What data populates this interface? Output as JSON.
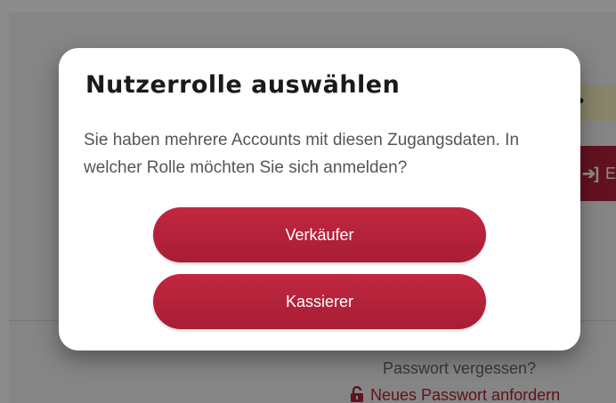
{
  "modal": {
    "title": "Nutzerrolle auswählen",
    "text": "Sie haben mehrere Accounts mit diesen Zugangsdaten. In welcher Rolle möchten Sie sich anmelden?",
    "buttons": [
      {
        "label": "Verkäufer"
      },
      {
        "label": "Kassierer"
      }
    ]
  },
  "background": {
    "field_value": "••",
    "login_button_label": "E",
    "login_icon": "sign-in-icon",
    "forgot_password_text": "Passwort vergessen?",
    "reset_password_link": "Neues Passwort anfordern",
    "reset_icon": "unlock-icon"
  },
  "colors": {
    "primary": "#b3213a",
    "overlay": "rgba(0,0,0,0.45)",
    "field_highlight": "#f4f0c2",
    "text_muted": "#555555"
  }
}
